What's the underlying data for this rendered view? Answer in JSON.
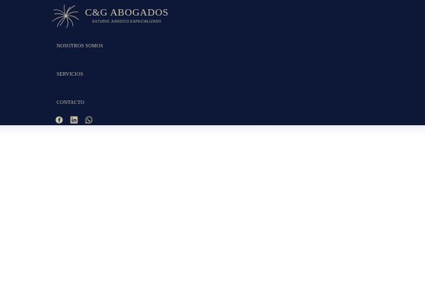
{
  "brand": {
    "name": "C&G ABOGADOS",
    "tagline": "ESTUDIO JURIDICO ESPECIALIZADO",
    "logo_icon": "starburst-logo-icon"
  },
  "nav": {
    "items": [
      {
        "label": "NOSOTROS SOMOS"
      },
      {
        "label": "SERVICIOS"
      },
      {
        "label": "CONTACTO"
      }
    ]
  },
  "social": {
    "icons": [
      "facebook-icon",
      "linkedin-icon",
      "whatsapp-icon"
    ]
  },
  "colors": {
    "header_bg": "#0d1838",
    "gold": "#cfc5a8",
    "page_bg": "#ffffff"
  }
}
